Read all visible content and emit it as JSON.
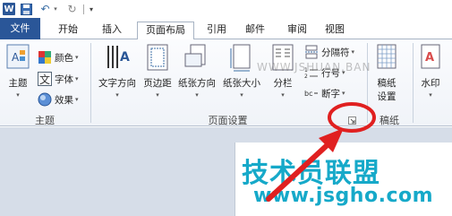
{
  "quick_access": {
    "app_icon": "word-icon",
    "app_letter": "W",
    "items": [
      "save-icon",
      "undo-icon",
      "redo-icon",
      "customize-icon"
    ]
  },
  "tabs": {
    "file": "文件",
    "home": "开始",
    "insert": "插入",
    "page_layout": "页面布局",
    "references": "引用",
    "mailings": "邮件",
    "review": "审阅",
    "view": "视图"
  },
  "ribbon": {
    "themes_group": {
      "label": "主题",
      "theme_button": "主题",
      "colors": "颜色",
      "fonts": "字体",
      "effects": "效果"
    },
    "page_setup_group": {
      "label": "页面设置",
      "text_direction": "文字方向",
      "margins": "页边距",
      "orientation": "纸张方向",
      "size": "纸张大小",
      "columns": "分栏",
      "breaks": "分隔符",
      "line_numbers": "行号",
      "hyphenation": "断字"
    },
    "draft_group": {
      "label": "稿纸",
      "draft_settings_line1": "稿纸",
      "draft_settings_line2": "设置"
    },
    "background_group": {
      "watermark": "水印"
    }
  },
  "watermark": {
    "site_overlay": "WWW.JSHUAN.BAN",
    "title": "技术员联盟",
    "url": "www.jsgho.com"
  },
  "colors": {
    "file_tab": "#2a5698",
    "arrow": "#e02020",
    "watermark": "#16a9c9"
  }
}
